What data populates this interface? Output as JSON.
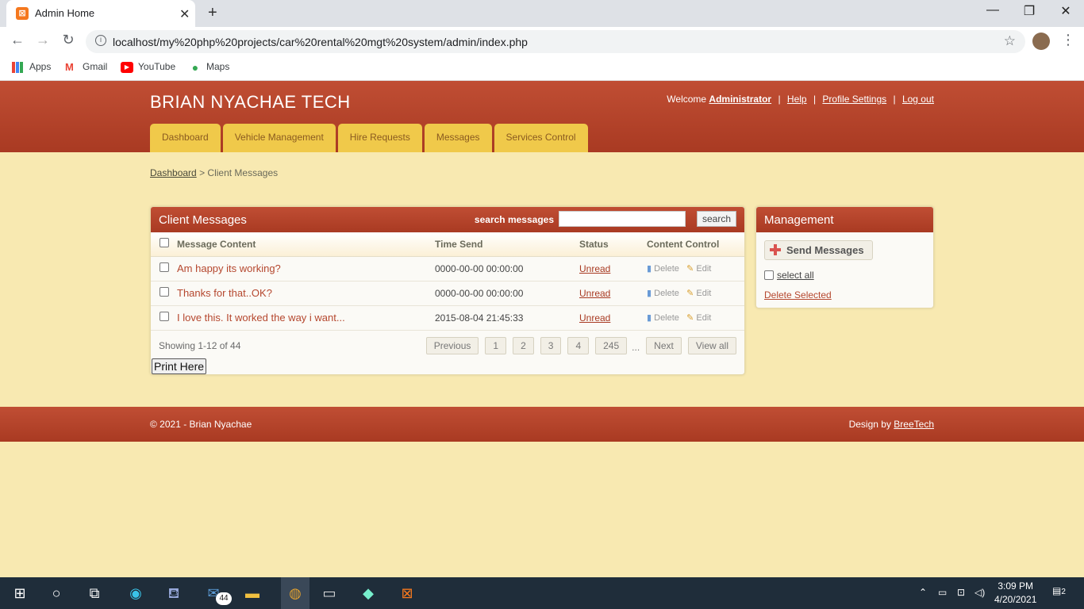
{
  "browser": {
    "tab_title": "Admin Home",
    "url": "localhost/my%20php%20projects/car%20rental%20mgt%20system/admin/index.php",
    "bookmarks": [
      "Apps",
      "Gmail",
      "YouTube",
      "Maps"
    ]
  },
  "site": {
    "title": "BRIAN NYACHAE TECH",
    "welcome": "Welcome",
    "user": "Administrator",
    "help": "Help",
    "profile_settings": "Profile Settings",
    "logout": "Log out"
  },
  "nav": [
    "Dashboard",
    "Vehicle Management",
    "Hire Requests",
    "Messages",
    "Services Control"
  ],
  "breadcrumb": {
    "home": "Dashboard",
    "separator": ">",
    "current": "Client Messages"
  },
  "messages_panel": {
    "title": "Client Messages",
    "search_label": "search messages",
    "search_placeholder": "",
    "search_button": "search",
    "columns": [
      "Message Content",
      "Time Send",
      "Status",
      "Content Control"
    ],
    "rows": [
      {
        "content": "Am happy its working?",
        "time": "0000-00-00 00:00:00",
        "status": "Unread",
        "delete": "Delete",
        "edit": "Edit"
      },
      {
        "content": "Thanks for that..OK?",
        "time": "0000-00-00 00:00:00",
        "status": "Unread",
        "delete": "Delete",
        "edit": "Edit"
      },
      {
        "content": "I love this. It worked the way i want...",
        "time": "2015-08-04 21:45:33",
        "status": "Unread",
        "delete": "Delete",
        "edit": "Edit"
      }
    ],
    "showing": "Showing 1-12 of 44",
    "pager": {
      "previous": "Previous",
      "pages": [
        "1",
        "2",
        "3",
        "4",
        "245"
      ],
      "ellipsis": "...",
      "next": "Next",
      "view_all": "View all"
    },
    "print_button": "Print Here"
  },
  "management_panel": {
    "title": "Management",
    "send_button": "Send Messages",
    "select_all": "select all",
    "delete_selected": "Delete Selected"
  },
  "footer": {
    "copyright": "© 2021 - Brian Nyachae",
    "design_label": "Design by",
    "design_link": "BreeTech"
  },
  "taskbar": {
    "mail_badge": "44",
    "time": "3:09 PM",
    "date": "4/20/2021",
    "notifications": "2"
  },
  "colors": {
    "header": "#b4432b",
    "background": "#f8e9b1",
    "nav_tab": "#f0c94a",
    "link_accent": "#b5472e"
  }
}
